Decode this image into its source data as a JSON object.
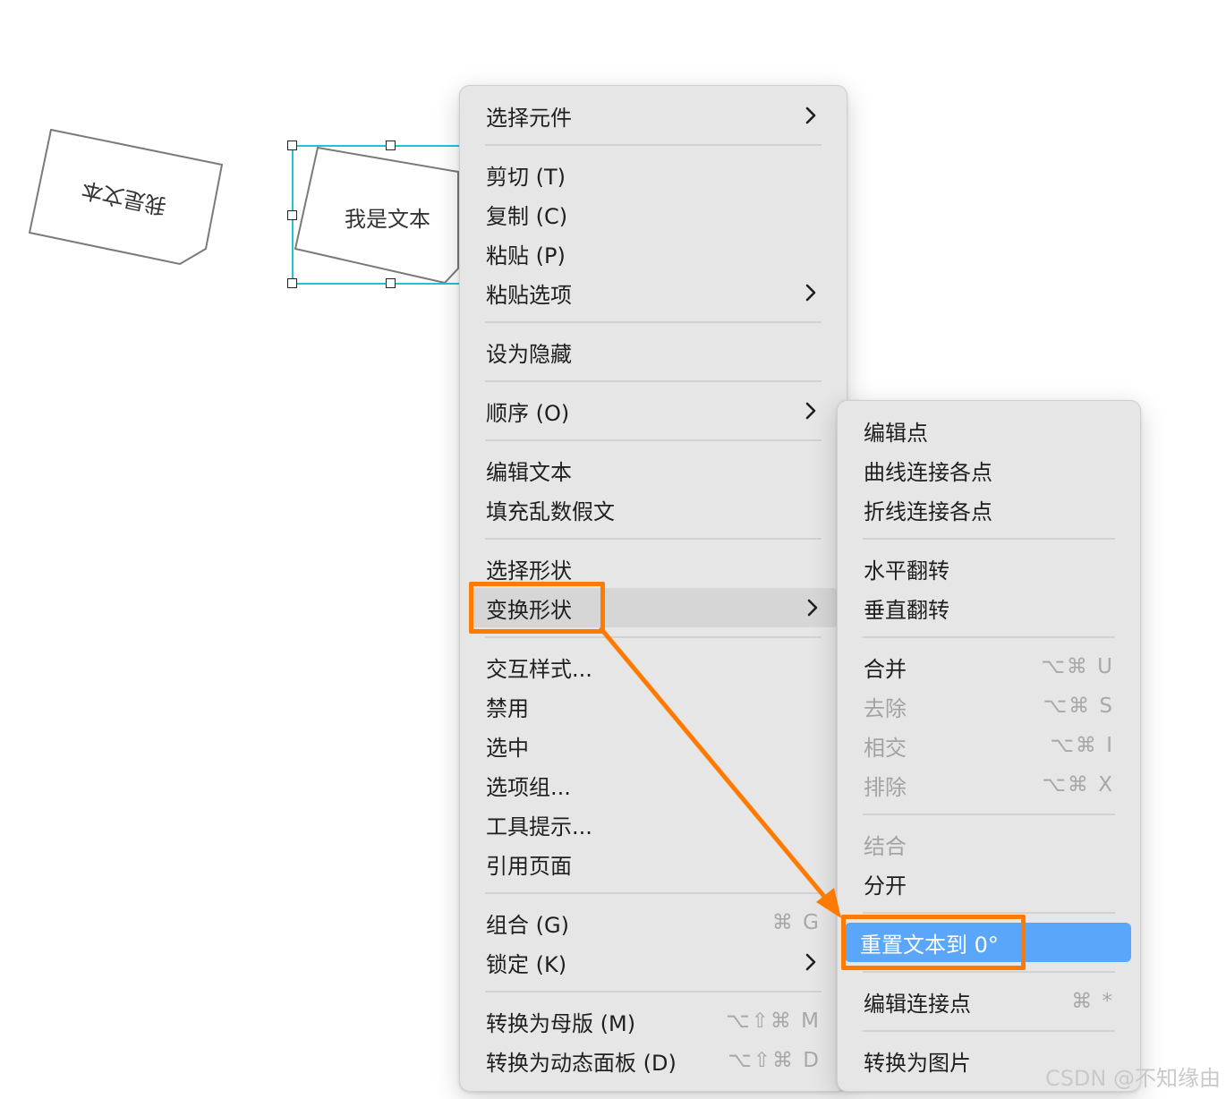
{
  "canvas": {
    "shape1_text": "我是文本",
    "shape2_text": "我是文本"
  },
  "context_menu": {
    "items": [
      {
        "label": "选择元件",
        "submenu": true
      },
      {
        "label": "剪切 (T)"
      },
      {
        "label": "复制 (C)"
      },
      {
        "label": "粘贴 (P)"
      },
      {
        "label": "粘贴选项",
        "submenu": true
      },
      {
        "label": "设为隐藏"
      },
      {
        "label": "顺序 (O)",
        "submenu": true
      },
      {
        "label": "编辑文本"
      },
      {
        "label": "填充乱数假文"
      },
      {
        "label": "选择形状"
      },
      {
        "label": "变换形状",
        "submenu": true,
        "state": "hovered"
      },
      {
        "label": "交互样式..."
      },
      {
        "label": "禁用"
      },
      {
        "label": "选中"
      },
      {
        "label": "选项组..."
      },
      {
        "label": "工具提示..."
      },
      {
        "label": "引用页面"
      },
      {
        "label": "组合 (G)",
        "shortcut": "⌘ G"
      },
      {
        "label": "锁定 (K)",
        "submenu": true
      },
      {
        "label": "转换为母版 (M)",
        "shortcut": "⌥⇧⌘ M"
      },
      {
        "label": "转换为动态面板 (D)",
        "shortcut": "⌥⇧⌘ D"
      }
    ]
  },
  "submenu": {
    "items": [
      {
        "label": "编辑点"
      },
      {
        "label": "曲线连接各点"
      },
      {
        "label": "折线连接各点"
      },
      {
        "label": "水平翻转"
      },
      {
        "label": "垂直翻转"
      },
      {
        "label": "合并",
        "shortcut": "⌥⌘ U"
      },
      {
        "label": "去除",
        "shortcut": "⌥⌘ S",
        "disabled": true
      },
      {
        "label": "相交",
        "shortcut": "⌥⌘ I",
        "disabled": true
      },
      {
        "label": "排除",
        "shortcut": "⌥⌘ X",
        "disabled": true
      },
      {
        "label": "结合",
        "disabled": true
      },
      {
        "label": "分开"
      },
      {
        "label": "重置文本到 0°",
        "state": "selected"
      },
      {
        "label": "编辑连接点",
        "shortcut": "⌘ *"
      },
      {
        "label": "转换为图片"
      }
    ]
  },
  "annotation": {
    "color": "#ff7a00"
  },
  "colors": {
    "selection": "#20c4d4",
    "menu_bg": "#e6e6e6",
    "selected_item": "#5aa6fb",
    "hover_item": "#d6d6d6"
  },
  "watermark": "CSDN @不知缘由"
}
